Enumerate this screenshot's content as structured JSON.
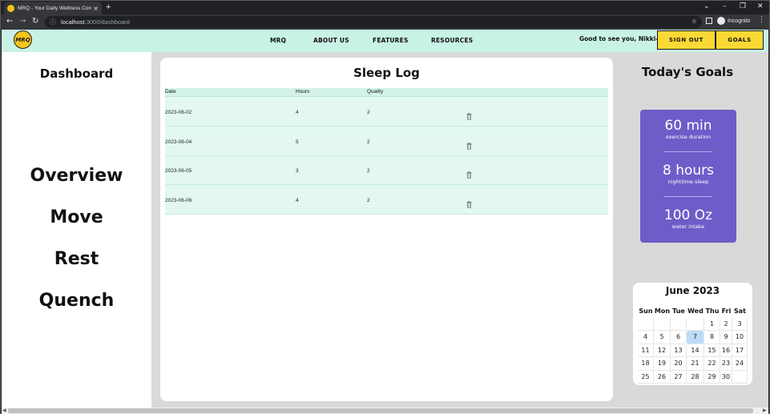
{
  "browser": {
    "tab_title": "MRQ - Your Daily Wellness Comp...",
    "tab_close": "×",
    "new_tab": "+",
    "url_host": "localhost",
    "url_path": ":3000/dashboard",
    "incognito_label": "Incognito",
    "window_controls": [
      "⌄",
      "–",
      "❐",
      "✕"
    ],
    "nav": {
      "back": "←",
      "forward": "→",
      "reload": "↻"
    },
    "star": "☆",
    "menu": "⋮"
  },
  "navbar": {
    "logo_text": "MRQ",
    "links": [
      "MRQ",
      "ABOUT US",
      "FEATURES",
      "RESOURCES"
    ],
    "greeting": "Good to see you, Nikki-a",
    "sign_out": "SIGN OUT",
    "goals": "GOALS",
    "accent": "#c8f2e6",
    "button_color": "#fbd935"
  },
  "sidebar": {
    "title": "Dashboard",
    "items": [
      "Overview",
      "Move",
      "Rest",
      "Quench"
    ]
  },
  "sleep_log": {
    "title": "Sleep Log",
    "columns": [
      "Date",
      "Hours",
      "Quality"
    ],
    "rows": [
      {
        "date": "2023-06-02",
        "hours": "4",
        "quality": "2",
        "action_icon": "trash-icon"
      },
      {
        "date": "2023-06-04",
        "hours": "5",
        "quality": "2",
        "action_icon": "trash-icon"
      },
      {
        "date": "2023-06-05",
        "hours": "3",
        "quality": "2",
        "action_icon": "trash-icon"
      },
      {
        "date": "2023-06-06",
        "hours": "4",
        "quality": "2",
        "action_icon": "trash-icon"
      }
    ]
  },
  "goals": {
    "title": "Today's Goals",
    "box_color": "#6f5cc8",
    "items": [
      {
        "value": "60 min",
        "label": "exercise duration"
      },
      {
        "value": "8 hours",
        "label": "nighttime sleep"
      },
      {
        "value": "100 Oz",
        "label": "water intake"
      }
    ]
  },
  "calendar": {
    "title": "June 2023",
    "weekdays": [
      "Sun",
      "Mon",
      "Tue",
      "Wed",
      "Thu",
      "Fri",
      "Sat"
    ],
    "weeks": [
      [
        "",
        "",
        "",
        "",
        "1",
        "2",
        "3"
      ],
      [
        "4",
        "5",
        "6",
        "7",
        "8",
        "9",
        "10"
      ],
      [
        "11",
        "12",
        "13",
        "14",
        "15",
        "16",
        "17"
      ],
      [
        "18",
        "19",
        "20",
        "21",
        "22",
        "23",
        "24"
      ],
      [
        "25",
        "26",
        "27",
        "28",
        "29",
        "30",
        ""
      ]
    ],
    "today": "7",
    "today_color": "#bcdcf7"
  }
}
